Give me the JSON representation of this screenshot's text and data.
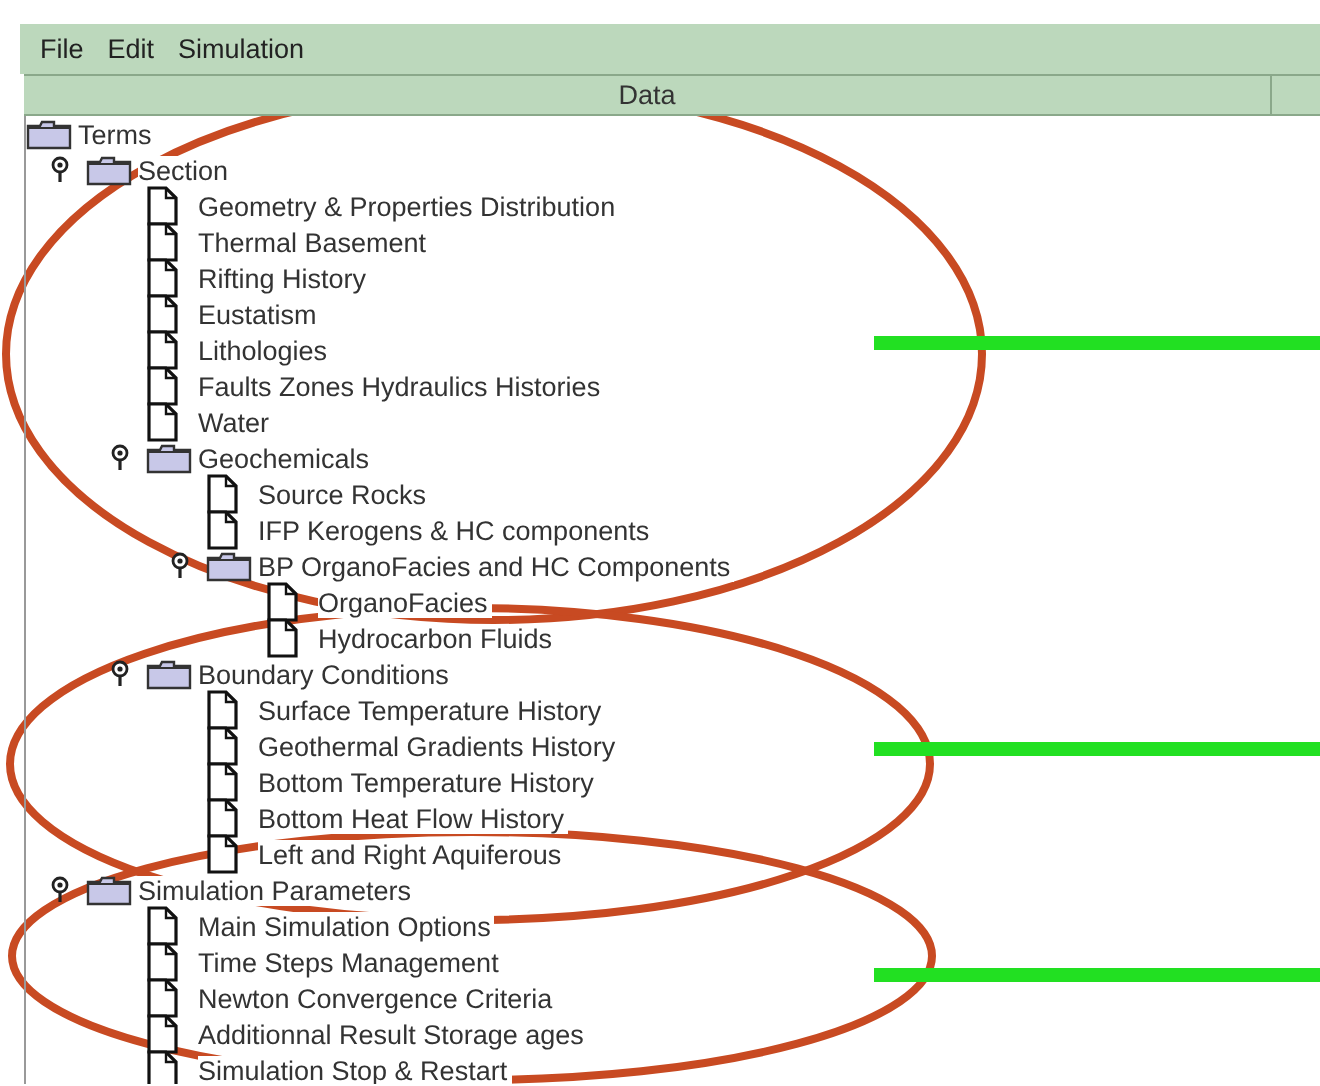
{
  "menu": [
    {
      "label": "File"
    },
    {
      "label": "Edit"
    },
    {
      "label": "Simulation"
    }
  ],
  "table": {
    "columns": [
      "Data"
    ]
  },
  "tree": {
    "label": "Terms",
    "kind": "folder",
    "children": [
      {
        "label": "Section",
        "kind": "folder",
        "expanded": true,
        "children": [
          {
            "label": "Geometry & Properties Distribution",
            "kind": "leaf"
          },
          {
            "label": "Thermal Basement",
            "kind": "leaf"
          },
          {
            "label": "Rifting History",
            "kind": "leaf"
          },
          {
            "label": "Eustatism",
            "kind": "leaf"
          },
          {
            "label": "Lithologies",
            "kind": "leaf"
          },
          {
            "label": "Faults Zones Hydraulics Histories",
            "kind": "leaf"
          },
          {
            "label": "Water",
            "kind": "leaf"
          },
          {
            "label": "Geochemicals",
            "kind": "folder",
            "expanded": true,
            "children": [
              {
                "label": "Source Rocks",
                "kind": "leaf"
              },
              {
                "label": "IFP Kerogens & HC components",
                "kind": "leaf"
              },
              {
                "label": "BP OrganoFacies and HC Components",
                "kind": "folder",
                "expanded": true,
                "children": [
                  {
                    "label": "OrganoFacies",
                    "kind": "leaf"
                  },
                  {
                    "label": "Hydrocarbon Fluids",
                    "kind": "leaf"
                  }
                ]
              }
            ]
          },
          {
            "label": "Boundary Conditions",
            "kind": "folder",
            "expanded": true,
            "children": [
              {
                "label": "Surface Temperature History",
                "kind": "leaf"
              },
              {
                "label": "Geothermal Gradients History",
                "kind": "leaf"
              },
              {
                "label": "Bottom Temperature History",
                "kind": "leaf"
              },
              {
                "label": "Bottom Heat Flow History",
                "kind": "leaf"
              },
              {
                "label": "Left and Right Aquiferous",
                "kind": "leaf"
              }
            ]
          }
        ]
      },
      {
        "label": "Simulation Parameters",
        "kind": "folder",
        "expanded": true,
        "children": [
          {
            "label": "Main Simulation Options",
            "kind": "leaf"
          },
          {
            "label": "Time Steps Management",
            "kind": "leaf"
          },
          {
            "label": "Newton Convergence Criteria",
            "kind": "leaf"
          },
          {
            "label": "Additionnal Result Storage ages",
            "kind": "leaf"
          },
          {
            "label": "Simulation Stop & Restart",
            "kind": "leaf"
          }
        ]
      }
    ]
  }
}
